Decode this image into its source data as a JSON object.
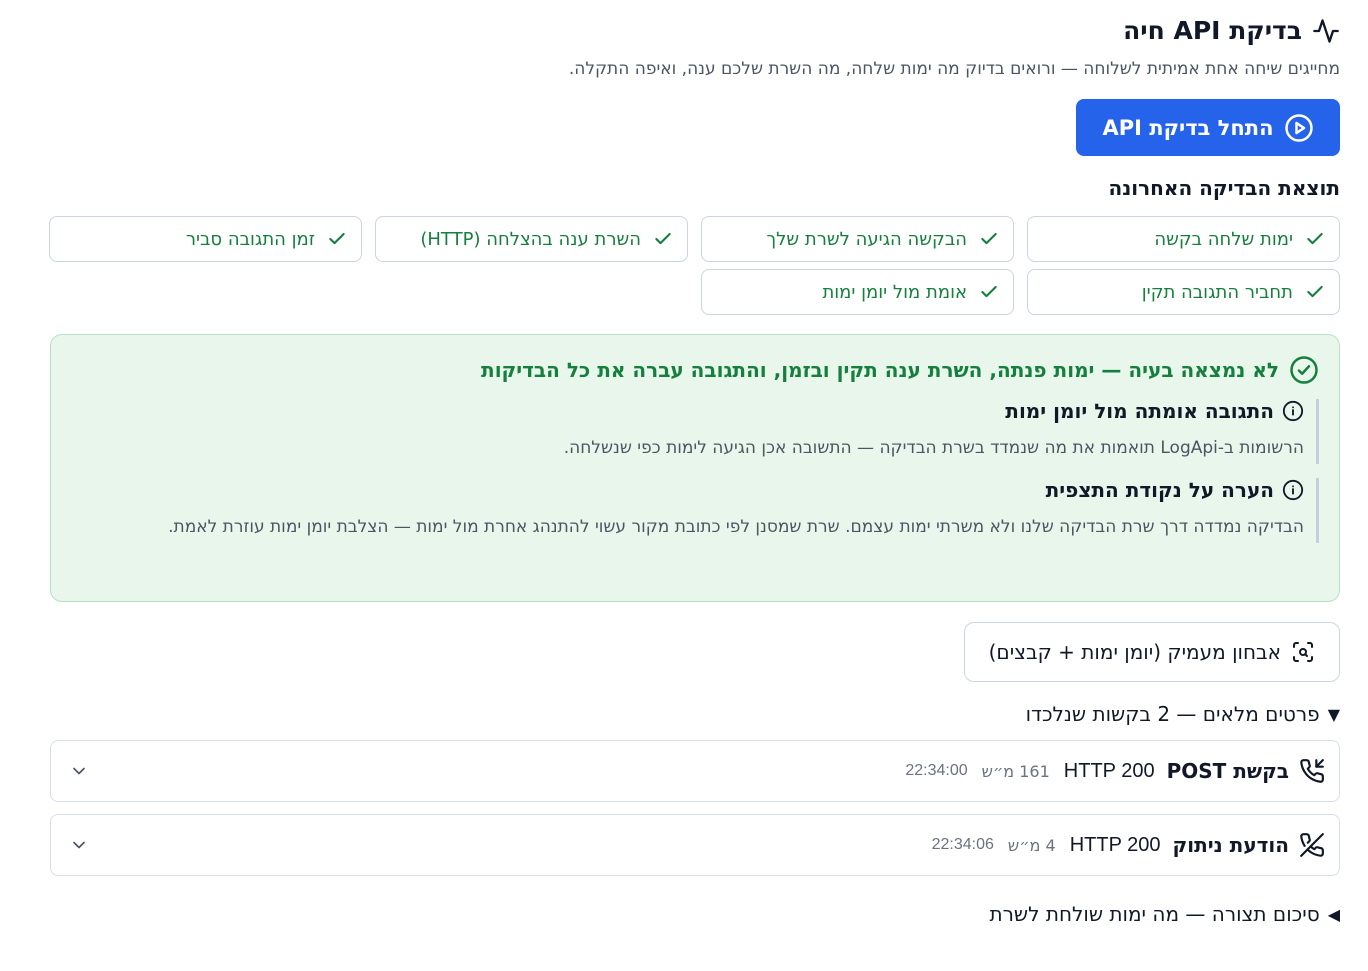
{
  "header": {
    "title": "בדיקת API חיה",
    "subtitle": "מחייגים שיחה אחת אמיתית לשלוחה — ורואים בדיוק מה ימות שלחה, מה השרת שלכם ענה, ואיפה התקלה."
  },
  "start_button": {
    "label": "התחל בדיקת API"
  },
  "last_result": {
    "title": "תוצאת הבדיקה האחרונה"
  },
  "checks": [
    {
      "label": "ימות שלחה בקשה"
    },
    {
      "label": "הבקשה הגיעה לשרת שלך"
    },
    {
      "label": "השרת ענה בהצלחה (HTTP)"
    },
    {
      "label": "זמן התגובה סביר"
    },
    {
      "label": "תחביר התגובה תקין"
    },
    {
      "label": "אומת מול יומן ימות"
    }
  ],
  "result": {
    "headline": "לא נמצאה בעיה — ימות פנתה, השרת ענה תקין ובזמן, והתגובה עברה את כל הבדיקות",
    "notes": [
      {
        "title": "התגובה אומתה מול יומן ימות",
        "text": "הרשומות ב-LogApi תואמות את מה שנמדד בשרת הבדיקה — התשובה אכן הגיעה לימות כפי שנשלחה."
      },
      {
        "title": "הערה על נקודת התצפית",
        "text": "הבדיקה נמדדה דרך שרת הבדיקה שלנו ולא משרתי ימות עצמם. שרת שמסנן לפי כתובת מקור עשוי להתנהג אחרת מול ימות — הצלבת יומן ימות עוזרת לאמת."
      }
    ]
  },
  "deep_button": {
    "label": "אבחון מעמיק (יומן ימות + קבצים)"
  },
  "details": {
    "summary": "פרטים מלאים — 2 בקשות שנלכדו",
    "requests": [
      {
        "title": "בקשת POST",
        "status": "HTTP 200",
        "duration": "161 מ״ש",
        "time": "22:34:00"
      },
      {
        "title": "הודעת ניתוק",
        "status": "HTTP 200",
        "duration": "4 מ״ש",
        "time": "22:34:06"
      }
    ]
  },
  "summary2": {
    "label": "סיכום תצורה — מה ימות שולחת לשרת"
  },
  "colors": {
    "primary": "#2563eb",
    "success": "#15803d",
    "success_bg": "#e8f6ec",
    "border": "#cbd5e1"
  }
}
